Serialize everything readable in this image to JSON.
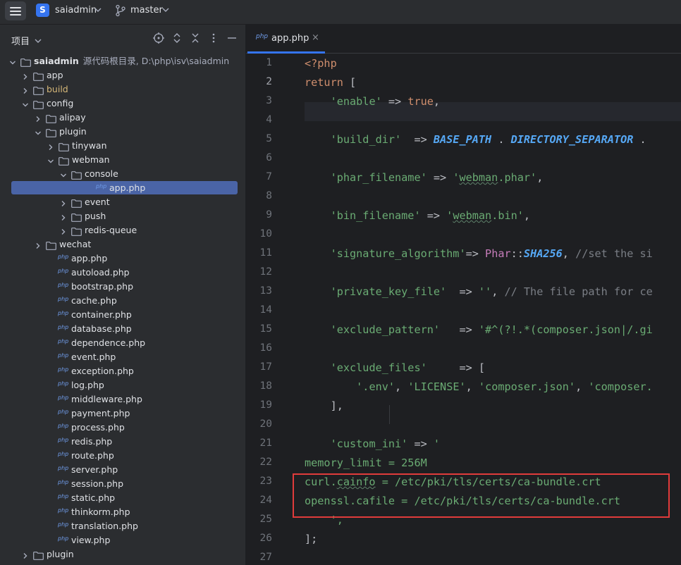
{
  "titlebar": {
    "project_badge": "S",
    "project_name": "saiadmin",
    "branch": "master"
  },
  "project_panel": {
    "title": "项目",
    "tree": [
      {
        "label": "saiadmin",
        "hint": "源代码根目录, D:\\php\\isv\\saiadmin",
        "type": "folder",
        "depth": 0,
        "arrow": "down",
        "bold": true
      },
      {
        "label": "app",
        "type": "folder",
        "depth": 1,
        "arrow": "right"
      },
      {
        "label": "build",
        "type": "folder",
        "depth": 1,
        "arrow": "right",
        "yellow": true
      },
      {
        "label": "config",
        "type": "folder",
        "depth": 1,
        "arrow": "down"
      },
      {
        "label": "alipay",
        "type": "folder",
        "depth": 2,
        "arrow": "right"
      },
      {
        "label": "plugin",
        "type": "folder",
        "depth": 2,
        "arrow": "down"
      },
      {
        "label": "tinywan",
        "type": "folder",
        "depth": 3,
        "arrow": "right"
      },
      {
        "label": "webman",
        "type": "folder",
        "depth": 3,
        "arrow": "down"
      },
      {
        "label": "console",
        "type": "folder",
        "depth": 4,
        "arrow": "down"
      },
      {
        "label": "app.php",
        "type": "php",
        "depth": 5,
        "selected": true
      },
      {
        "label": "event",
        "type": "folder",
        "depth": 4,
        "arrow": "right"
      },
      {
        "label": "push",
        "type": "folder",
        "depth": 4,
        "arrow": "right"
      },
      {
        "label": "redis-queue",
        "type": "folder",
        "depth": 4,
        "arrow": "right"
      },
      {
        "label": "wechat",
        "type": "folder",
        "depth": 2,
        "arrow": "right"
      },
      {
        "label": "app.php",
        "type": "php",
        "depth": 2
      },
      {
        "label": "autoload.php",
        "type": "php",
        "depth": 2
      },
      {
        "label": "bootstrap.php",
        "type": "php",
        "depth": 2
      },
      {
        "label": "cache.php",
        "type": "php",
        "depth": 2
      },
      {
        "label": "container.php",
        "type": "php",
        "depth": 2
      },
      {
        "label": "database.php",
        "type": "php",
        "depth": 2
      },
      {
        "label": "dependence.php",
        "type": "php",
        "depth": 2
      },
      {
        "label": "event.php",
        "type": "php",
        "depth": 2
      },
      {
        "label": "exception.php",
        "type": "php",
        "depth": 2
      },
      {
        "label": "log.php",
        "type": "php",
        "depth": 2
      },
      {
        "label": "middleware.php",
        "type": "php",
        "depth": 2
      },
      {
        "label": "payment.php",
        "type": "php",
        "depth": 2
      },
      {
        "label": "process.php",
        "type": "php",
        "depth": 2
      },
      {
        "label": "redis.php",
        "type": "php",
        "depth": 2
      },
      {
        "label": "route.php",
        "type": "php",
        "depth": 2
      },
      {
        "label": "server.php",
        "type": "php",
        "depth": 2
      },
      {
        "label": "session.php",
        "type": "php",
        "depth": 2
      },
      {
        "label": "static.php",
        "type": "php",
        "depth": 2
      },
      {
        "label": "thinkorm.php",
        "type": "php",
        "depth": 2
      },
      {
        "label": "translation.php",
        "type": "php",
        "depth": 2
      },
      {
        "label": "view.php",
        "type": "php",
        "depth": 2
      },
      {
        "label": "plugin",
        "type": "folder",
        "depth": 1,
        "arrow": "right"
      }
    ]
  },
  "editor": {
    "tab_icon": "php",
    "tab_label": "app.php",
    "tab_close": "×",
    "current_line": 2,
    "lines": [
      {
        "n": "1",
        "tokens": [
          {
            "t": "<?php",
            "c": "kw"
          }
        ]
      },
      {
        "n": "2",
        "tokens": [
          {
            "t": "return",
            "c": "kw"
          },
          {
            "t": " [",
            "c": "plain"
          }
        ]
      },
      {
        "n": "3",
        "tokens": [
          {
            "t": "    ",
            "c": "plain"
          },
          {
            "t": "'enable'",
            "c": "str"
          },
          {
            "t": " => ",
            "c": "plain"
          },
          {
            "t": "true",
            "c": "kw"
          },
          {
            "t": ",",
            "c": "plain"
          }
        ]
      },
      {
        "n": "4",
        "tokens": []
      },
      {
        "n": "5",
        "tokens": [
          {
            "t": "    ",
            "c": "plain"
          },
          {
            "t": "'build_dir'",
            "c": "str"
          },
          {
            "t": "  => ",
            "c": "plain"
          },
          {
            "t": "BASE_PATH",
            "c": "const"
          },
          {
            "t": " . ",
            "c": "plain"
          },
          {
            "t": "DIRECTORY_SEPARATOR",
            "c": "const"
          },
          {
            "t": " . ",
            "c": "plain"
          }
        ]
      },
      {
        "n": "6",
        "tokens": []
      },
      {
        "n": "7",
        "tokens": [
          {
            "t": "    ",
            "c": "plain"
          },
          {
            "t": "'phar_filename'",
            "c": "str"
          },
          {
            "t": " => ",
            "c": "plain"
          },
          {
            "t": "'",
            "c": "str"
          },
          {
            "t": "webman",
            "c": "str squig"
          },
          {
            "t": ".phar'",
            "c": "str"
          },
          {
            "t": ",",
            "c": "plain"
          }
        ]
      },
      {
        "n": "8",
        "tokens": []
      },
      {
        "n": "9",
        "tokens": [
          {
            "t": "    ",
            "c": "plain"
          },
          {
            "t": "'bin_filename'",
            "c": "str"
          },
          {
            "t": " => ",
            "c": "plain"
          },
          {
            "t": "'",
            "c": "str"
          },
          {
            "t": "webman",
            "c": "str squig"
          },
          {
            "t": ".bin'",
            "c": "str"
          },
          {
            "t": ",",
            "c": "plain"
          }
        ]
      },
      {
        "n": "10",
        "tokens": []
      },
      {
        "n": "11",
        "tokens": [
          {
            "t": "    ",
            "c": "plain"
          },
          {
            "t": "'signature_algorithm'",
            "c": "str"
          },
          {
            "t": "=> ",
            "c": "plain"
          },
          {
            "t": "Phar",
            "c": "cls"
          },
          {
            "t": "::",
            "c": "plain"
          },
          {
            "t": "SHA256",
            "c": "const"
          },
          {
            "t": ", ",
            "c": "plain"
          },
          {
            "t": "//set the si",
            "c": "cmt"
          }
        ]
      },
      {
        "n": "12",
        "tokens": []
      },
      {
        "n": "13",
        "tokens": [
          {
            "t": "    ",
            "c": "plain"
          },
          {
            "t": "'private_key_file'",
            "c": "str"
          },
          {
            "t": "  => ",
            "c": "plain"
          },
          {
            "t": "''",
            "c": "str"
          },
          {
            "t": ", ",
            "c": "plain"
          },
          {
            "t": "// The file path for ce",
            "c": "cmt"
          }
        ]
      },
      {
        "n": "14",
        "tokens": []
      },
      {
        "n": "15",
        "tokens": [
          {
            "t": "    ",
            "c": "plain"
          },
          {
            "t": "'exclude_pattern'",
            "c": "str"
          },
          {
            "t": "   => ",
            "c": "plain"
          },
          {
            "t": "'#^(?!.*(composer.json|/.gi",
            "c": "str"
          }
        ]
      },
      {
        "n": "16",
        "tokens": []
      },
      {
        "n": "17",
        "tokens": [
          {
            "t": "    ",
            "c": "plain"
          },
          {
            "t": "'exclude_files'",
            "c": "str"
          },
          {
            "t": "     => [",
            "c": "plain"
          }
        ]
      },
      {
        "n": "18",
        "tokens": [
          {
            "t": "        ",
            "c": "plain"
          },
          {
            "t": "'.env'",
            "c": "str"
          },
          {
            "t": ", ",
            "c": "plain"
          },
          {
            "t": "'LICENSE'",
            "c": "str"
          },
          {
            "t": ", ",
            "c": "plain"
          },
          {
            "t": "'composer.json'",
            "c": "str"
          },
          {
            "t": ", ",
            "c": "plain"
          },
          {
            "t": "'composer.",
            "c": "str"
          }
        ]
      },
      {
        "n": "19",
        "tokens": [
          {
            "t": "    ],",
            "c": "plain"
          }
        ]
      },
      {
        "n": "20",
        "tokens": []
      },
      {
        "n": "21",
        "tokens": [
          {
            "t": "    ",
            "c": "plain"
          },
          {
            "t": "'custom_ini'",
            "c": "str"
          },
          {
            "t": " => ",
            "c": "plain"
          },
          {
            "t": "'",
            "c": "str"
          }
        ]
      },
      {
        "n": "22",
        "tokens": [
          {
            "t": "memory_limit = 256M",
            "c": "str"
          }
        ]
      },
      {
        "n": "23",
        "tokens": [
          {
            "t": "curl.",
            "c": "str"
          },
          {
            "t": "cainfo",
            "c": "str squig"
          },
          {
            "t": " = /etc/pki/tls/certs/ca-bundle.crt",
            "c": "str"
          }
        ]
      },
      {
        "n": "24",
        "tokens": [
          {
            "t": "openssl.cafile = /etc/pki/tls/certs/ca-bundle.crt",
            "c": "str"
          }
        ]
      },
      {
        "n": "25",
        "tokens": [
          {
            "t": "    ',",
            "c": "str"
          }
        ]
      },
      {
        "n": "26",
        "tokens": [
          {
            "t": "];",
            "c": "plain"
          }
        ]
      },
      {
        "n": "27",
        "tokens": []
      }
    ]
  }
}
